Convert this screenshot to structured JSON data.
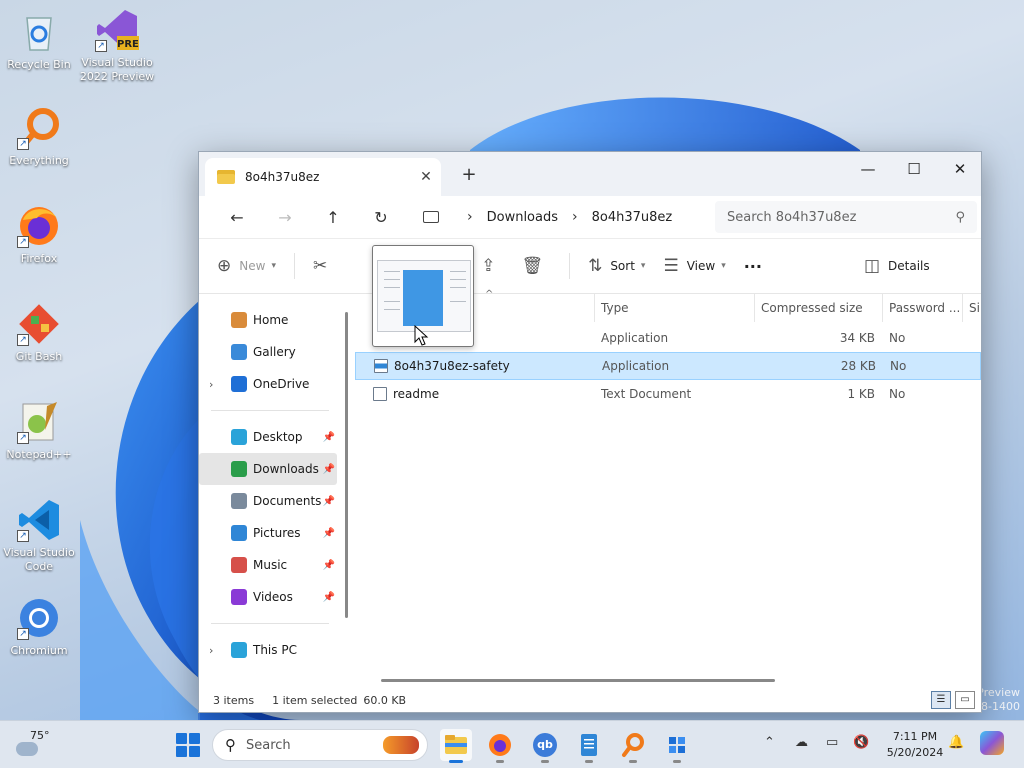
{
  "desktop": {
    "icons": [
      {
        "label": "Recycle Bin"
      },
      {
        "label": "Visual Studio 2022 Preview",
        "badge": "PRE"
      },
      {
        "label": "Everything"
      },
      {
        "label": "Firefox"
      },
      {
        "label": "Git Bash"
      },
      {
        "label": "Notepad++"
      },
      {
        "label": "Visual Studio Code"
      },
      {
        "label": "Chromium"
      }
    ],
    "watermark_line1": "Preview",
    "watermark_line2": "8-1400"
  },
  "window": {
    "tab_title": "8o4h37u8ez",
    "tab_close": "✕",
    "new_tab": "+",
    "minimize": "—",
    "maximize": "☐",
    "close": "✕",
    "nav": {
      "back": "←",
      "forward": "→",
      "up": "↑",
      "refresh": "↻"
    },
    "breadcrumb": [
      "Downloads",
      "8o4h37u8ez"
    ],
    "breadcrumb_sep": "›",
    "search_placeholder": "Search 8o4h37u8ez",
    "commands": {
      "new": "New",
      "sort": "Sort",
      "view": "View",
      "more": "···",
      "details": "Details"
    },
    "sidebar": {
      "items_top": [
        {
          "label": "Home",
          "color": "#d98b3a"
        },
        {
          "label": "Gallery",
          "color": "#3a8ad9"
        },
        {
          "label": "OneDrive",
          "color": "#1f6fd6",
          "expandable": true
        }
      ],
      "items_pinned": [
        {
          "label": "Desktop",
          "color": "#2aa3d9"
        },
        {
          "label": "Downloads",
          "color": "#2a9d4a",
          "selected": true
        },
        {
          "label": "Documents",
          "color": "#7a8a9c"
        },
        {
          "label": "Pictures",
          "color": "#2f86d6"
        },
        {
          "label": "Music",
          "color": "#d6504a"
        },
        {
          "label": "Videos",
          "color": "#8a3ad6"
        }
      ],
      "items_bottom": [
        {
          "label": "This PC",
          "color": "#2aa3d9",
          "expandable": true
        }
      ]
    },
    "columns": [
      "Type",
      "Compressed size",
      "Password ...",
      "Si"
    ],
    "files": [
      {
        "name": "",
        "type": "Application",
        "size": "34 KB",
        "password": "No"
      },
      {
        "name": "8o4h37u8ez-safety",
        "type": "Application",
        "size": "28 KB",
        "password": "No",
        "selected": true
      },
      {
        "name": "readme",
        "type": "Text Document",
        "size": "1 KB",
        "password": "No"
      }
    ],
    "status": {
      "items": "3 items",
      "selected": "1 item selected",
      "size": "60.0 KB"
    }
  },
  "taskbar": {
    "weather": "75°",
    "search_placeholder": "Search",
    "apps": [
      "File Explorer",
      "Firefox",
      "qBittorrent",
      "Notepad",
      "Everything",
      "Package"
    ],
    "app_qb_label": "qb",
    "clock_time": "7:11 PM",
    "clock_date": "5/20/2024"
  }
}
